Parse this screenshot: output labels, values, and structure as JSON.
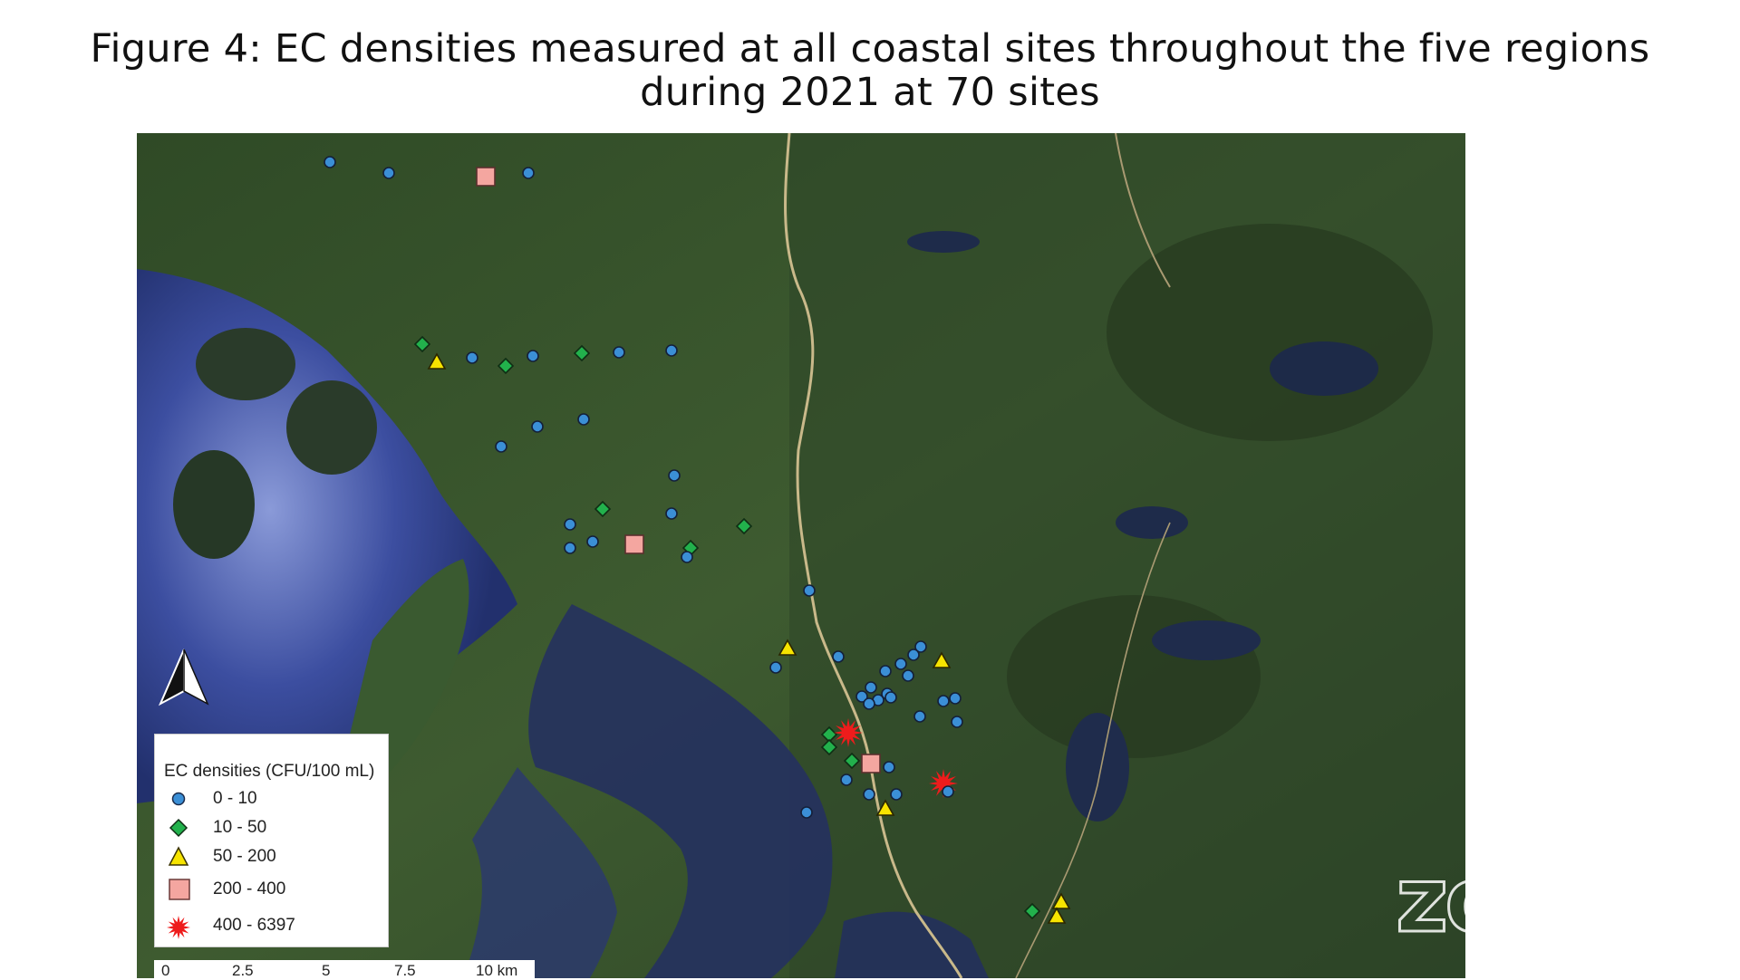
{
  "title": {
    "line1": "Figure 4: EC densities measured at all coastal sites throughout the five regions",
    "line2": "during 2021 at 70 sites"
  },
  "legend": {
    "title": "EC densities (CFU/100 mL)",
    "items": [
      {
        "label": "0 - 10",
        "symbol": "circle",
        "color": "#3b8fd6"
      },
      {
        "label": "10 - 50",
        "symbol": "diamond",
        "color": "#22b14c"
      },
      {
        "label": "50 - 200",
        "symbol": "triangle",
        "color": "#f7e400"
      },
      {
        "label": "200 - 400",
        "symbol": "square",
        "color": "#f4a6a0"
      },
      {
        "label": "400 - 6397",
        "symbol": "starburst",
        "color": "#ee1c1c"
      }
    ]
  },
  "scale_bar": {
    "labels": [
      "0",
      "2.5",
      "5",
      "7.5",
      "10 km"
    ]
  },
  "north_arrow": {
    "icon": "north-arrow-icon"
  },
  "watermark": {
    "text": "zoom"
  },
  "colors": {
    "water": "#2d3f8e",
    "land": "#3d5a2e",
    "road": "#c9b98a"
  }
}
